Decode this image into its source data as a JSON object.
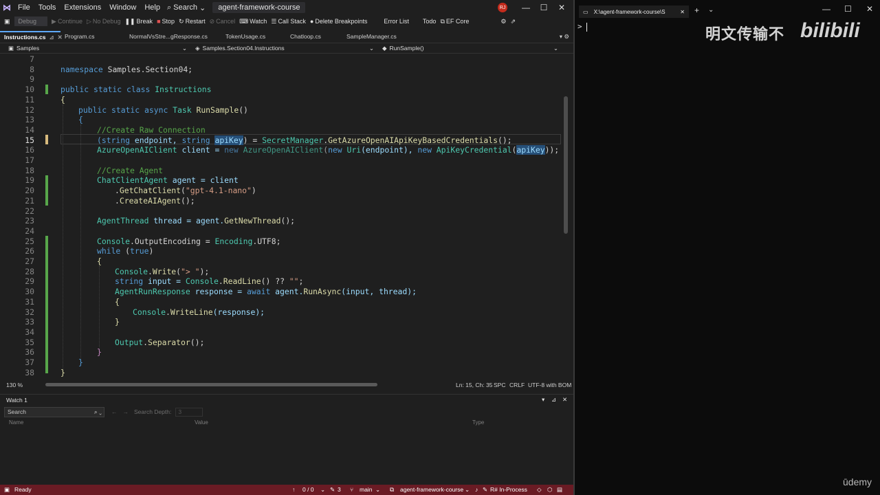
{
  "titlebar": {
    "menu": [
      "File",
      "Tools",
      "Extensions",
      "Window",
      "Help"
    ],
    "search": "Search",
    "solution": "agent-framework-course",
    "avatar": "RJ"
  },
  "toolbar": {
    "config": "Debug",
    "continue": "Continue",
    "nodebug": "No Debug",
    "break": "Break",
    "stop": "Stop",
    "restart": "Restart",
    "cancel": "Cancel",
    "watch": "Watch",
    "callstack": "Call Stack",
    "deletebp": "Delete Breakpoints",
    "errorlist": "Error List",
    "todo": "Todo",
    "efcore": "EF Core"
  },
  "tabs": [
    "Instructions.cs",
    "Program.cs",
    "NormalVsStre...gResponse.cs",
    "TokenUsage.cs",
    "Chatloop.cs",
    "SampleManager.cs"
  ],
  "navbar": {
    "project": "Samples",
    "type": "Samples.Section04.Instructions",
    "member": "RunSample()"
  },
  "editor": {
    "line_numbers": [
      "7",
      "8",
      "9",
      "10",
      "11",
      "12",
      "13",
      "14",
      "15",
      "16",
      "17",
      "18",
      "19",
      "20",
      "21",
      "22",
      "23",
      "24",
      "25",
      "26",
      "27",
      "28",
      "29",
      "30",
      "31",
      "32",
      "33",
      "34",
      "35",
      "36",
      "37",
      "38"
    ],
    "current_line": "15",
    "lines": {
      "l8_a": "namespace",
      "l8_b": " Samples.Section04;",
      "l10_a": "public static class",
      "l10_b": " Instructions",
      "l11": "{",
      "l12_a": "public static async",
      "l12_b": " Task ",
      "l12_c": "RunSample",
      "l12_d": "()",
      "l13": "{",
      "l14": "//Create Raw Connection",
      "l15_a": "(string",
      "l15_b": " endpoint, ",
      "l15_c": "string",
      "l15_d": " ",
      "l15_e": "apiKey",
      "l15_f": ") = ",
      "l15_g": "SecretManager",
      "l15_h": ".",
      "l15_i": "GetAzureOpenAIApiKeyBasedCredentials",
      "l15_j": "();",
      "l16_a": "AzureOpenAIClient",
      "l16_b": " client = ",
      "l16_c": "new",
      "l16_d": " AzureOpenAIClient",
      "l16_e": "(",
      "l16_f": "new",
      "l16_g": " Uri",
      "l16_h": "(endpoint), ",
      "l16_i": "new",
      "l16_j": " ApiKeyCredential",
      "l16_k": "(",
      "l16_l": "apiKey",
      "l16_m": "));",
      "l18": "//Create Agent",
      "l19_a": "ChatClientAgent",
      "l19_b": " agent = client",
      "l20_a": ".",
      "l20_b": "GetChatClient",
      "l20_c": "(",
      "l20_d": "\"gpt-4.1-nano\"",
      "l20_e": ")",
      "l21_a": ".",
      "l21_b": "CreateAIAgent",
      "l21_c": "();",
      "l23_a": "AgentThread",
      "l23_b": " thread = agent.",
      "l23_c": "GetNewThread",
      "l23_d": "();",
      "l25_a": "Console",
      "l25_b": ".OutputEncoding = ",
      "l25_c": "Encoding",
      "l25_d": ".UTF8;",
      "l26_a": "while",
      "l26_b": " (",
      "l26_c": "true",
      "l26_d": ")",
      "l27": "{",
      "l28_a": "Console",
      "l28_b": ".",
      "l28_c": "Write",
      "l28_d": "(",
      "l28_e": "\"> \"",
      "l28_f": ");",
      "l29_a": "string",
      "l29_b": " input = ",
      "l29_c": "Console",
      "l29_d": ".",
      "l29_e": "ReadLine",
      "l29_f": "() ?? ",
      "l29_g": "\"\"",
      "l29_h": ";",
      "l30_a": "AgentRunResponse",
      "l30_b": " response = ",
      "l30_c": "await",
      "l30_d": " agent.",
      "l30_e": "RunAsync",
      "l30_f": "(input, thread);",
      "l31": "{",
      "l32_a": "Console",
      "l32_b": ".",
      "l32_c": "WriteLine",
      "l32_d": "(response);",
      "l33": "}",
      "l35_a": "Output",
      "l35_b": ".",
      "l35_c": "Separator",
      "l35_d": "();",
      "l36": "}",
      "l37": "}",
      "l38": "}"
    }
  },
  "editor_status": {
    "zoom": "130 %",
    "position": "Ln: 15, Ch: 35",
    "mode": "SPC",
    "eol": "CRLF",
    "encoding": "UTF-8 with BOM"
  },
  "watch": {
    "title": "Watch 1",
    "search_placeholder": "Search",
    "search_depth_label": "Search Depth:",
    "search_depth_value": "3",
    "columns": [
      "Name",
      "Value",
      "Type"
    ]
  },
  "statusbar": {
    "ready": "Ready",
    "errors": "0 / 0",
    "edits": "3",
    "branch": "main",
    "repo": "agent-framework-course",
    "resharper": "R# In-Process"
  },
  "terminal": {
    "tab_title": "X:\\agent-framework-course\\S",
    "prompt": ">"
  },
  "watermark": {
    "chinese": "明文传输不",
    "bilibili": "bilibili",
    "udemy": "ūdemy"
  },
  "colors": {
    "statusbar": "#6a1b24",
    "keyword": "#569cd6",
    "type": "#4ec9b0",
    "method": "#dcdcaa",
    "comment": "#57a64a",
    "string": "#d69d85"
  }
}
